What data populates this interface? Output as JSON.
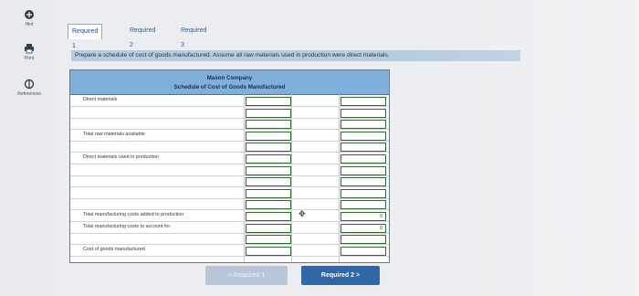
{
  "sidebar": {
    "items": [
      {
        "label": "Hint",
        "icon": "hint-icon"
      },
      {
        "label": "Print",
        "icon": "print-icon"
      },
      {
        "label": "References",
        "icon": "references-icon"
      }
    ]
  },
  "tabs": [
    {
      "label": "Required 1",
      "active": true
    },
    {
      "label": "Required 2",
      "active": false
    },
    {
      "label": "Required 3",
      "active": false
    }
  ],
  "instruction": "Prepare a schedule of cost of goods manufactured. Assume all raw materials used in production were direct materials.",
  "schedule": {
    "company": "Mason Company",
    "title": "Schedule of Cost of Goods Manufactured",
    "rows": [
      {
        "label": "Direct materials",
        "value": ""
      },
      {
        "label": "",
        "value": ""
      },
      {
        "label": "",
        "value": ""
      },
      {
        "label": "Total raw materials available",
        "value": ""
      },
      {
        "label": "",
        "value": ""
      },
      {
        "label": "Direct materials used in production",
        "value": ""
      },
      {
        "label": "",
        "value": ""
      },
      {
        "label": "",
        "value": ""
      },
      {
        "label": "",
        "value": ""
      },
      {
        "label": "",
        "value": ""
      },
      {
        "label": "Total manufacturing costs added to production",
        "value": "0"
      },
      {
        "label": "Total manufacturing costs to account for",
        "value": "0"
      },
      {
        "label": "",
        "value": ""
      },
      {
        "label": "Cost of goods manufactured",
        "value": ""
      }
    ]
  },
  "buttons": {
    "prev": "< Required 1",
    "next": "Required 2  >"
  },
  "colors": {
    "header": "#7fb0dc",
    "instruction_bg": "#b7ccdf",
    "next_button": "#2f67a8",
    "input_border": "#2f6a31"
  }
}
